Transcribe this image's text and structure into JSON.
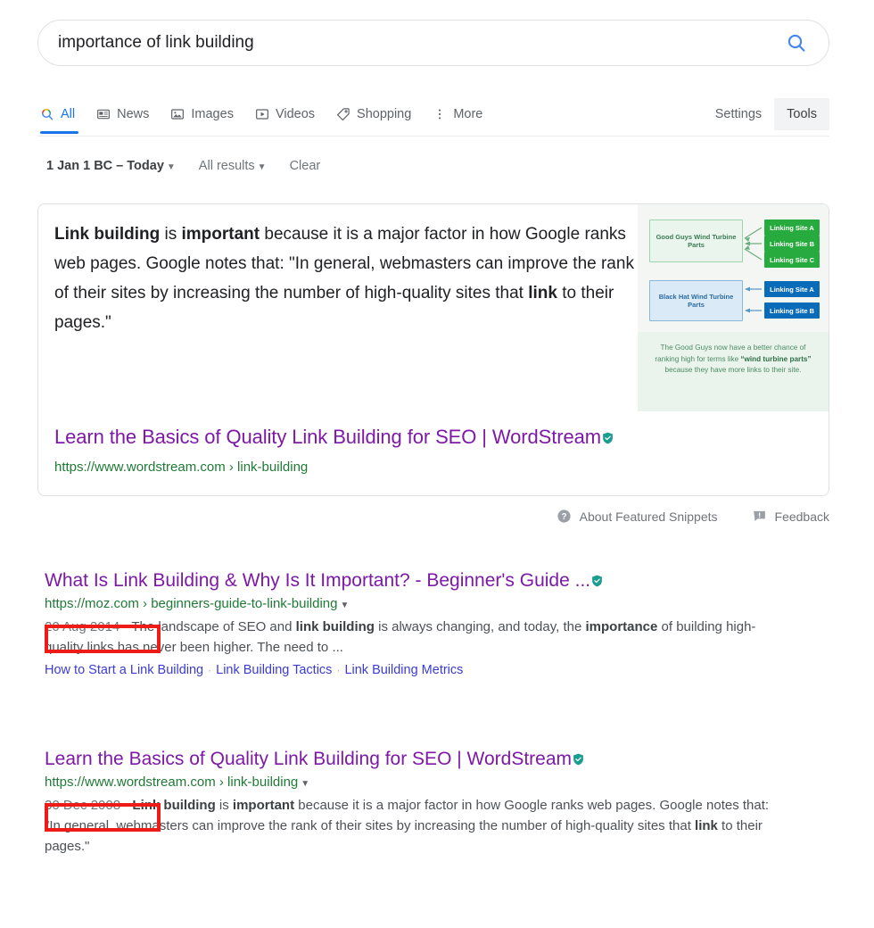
{
  "search": {
    "query": "importance of link building",
    "placeholder": "Search",
    "search_icon": "search-icon"
  },
  "tabs": [
    {
      "label": "All",
      "icon": "search-icon",
      "active": true
    },
    {
      "label": "News",
      "icon": "news-icon",
      "active": false
    },
    {
      "label": "Images",
      "icon": "image-icon",
      "active": false
    },
    {
      "label": "Videos",
      "icon": "video-icon",
      "active": false
    },
    {
      "label": "Shopping",
      "icon": "tag-icon",
      "active": false
    },
    {
      "label": "More",
      "icon": "more-vert-icon",
      "active": false
    }
  ],
  "tab_actions": {
    "settings": "Settings",
    "tools": "Tools"
  },
  "tools_row": {
    "date_range": "1 Jan 1 BC – Today",
    "result_type": "All results",
    "clear": "Clear",
    "caret": "▼"
  },
  "featured_snippet": {
    "text_parts": [
      {
        "text": "Link building",
        "bold": true
      },
      {
        "text": " is ",
        "bold": false
      },
      {
        "text": "important",
        "bold": true
      },
      {
        "text": " because it is a major factor in how Google ranks web pages. Google notes that: \"In general, webmasters can improve the rank of their sites by increasing the number of high-quality sites that ",
        "bold": false
      },
      {
        "text": "link",
        "bold": true
      },
      {
        "text": " to their pages.\"",
        "bold": false
      }
    ],
    "title": "Learn the Basics of Quality Link Building for SEO | WordStream",
    "url": "https://www.wordstream.com › link-building",
    "badge_icon": "verified-shield-icon",
    "thumbnail": {
      "good_box": "Good Guys Wind Turbine Parts",
      "bad_box": "Black Hat Wind Turbine Parts",
      "good_links": [
        "Linking Site A",
        "Linking Site B",
        "Linking Site C"
      ],
      "bad_links": [
        "Linking Site A",
        "Linking Site B"
      ],
      "caption_pre": "The Good Guys now have a better chance of ranking high for terms like ",
      "caption_bold": "“wind turbine parts”",
      "caption_post": " because they have more links to their site.",
      "colors": {
        "good_fill": "#eaf6ed",
        "good_link_fill": "#27ab3e",
        "bad_fill": "#dbeaf7",
        "bad_link_fill": "#0a6bb8",
        "caption_bg": "#eaf4ec"
      }
    },
    "footer": {
      "about": "About Featured Snippets",
      "about_icon": "help-circle-icon",
      "feedback": "Feedback",
      "feedback_icon": "flag-icon"
    }
  },
  "results": [
    {
      "title": "What Is Link Building & Why Is It Important? - Beginner's Guide ...",
      "badge_icon": "verified-shield-icon",
      "url": "https://moz.com › beginners-guide-to-link-building",
      "url_caret": "▼",
      "date": "20 Aug 2014",
      "desc_parts": [
        {
          "text": " - The landscape of SEO and ",
          "bold": false
        },
        {
          "text": "link building",
          "bold": true
        },
        {
          "text": " is always changing, and today, the ",
          "bold": false
        },
        {
          "text": "importance",
          "bold": true
        },
        {
          "text": " of building high-quality links has never been higher. The need to ...",
          "bold": false
        }
      ],
      "sitelinks": [
        "How to Start a Link Building",
        "Link Building Tactics",
        "Link Building Metrics"
      ],
      "sitelink_separator": "·"
    },
    {
      "title": "Learn the Basics of Quality Link Building for SEO | WordStream",
      "badge_icon": "verified-shield-icon",
      "url": "https://www.wordstream.com › link-building",
      "url_caret": "▼",
      "date": "30 Dec 2008",
      "desc_parts": [
        {
          "text": " - ",
          "bold": false
        },
        {
          "text": "Link building",
          "bold": true
        },
        {
          "text": " is ",
          "bold": false
        },
        {
          "text": "important",
          "bold": true
        },
        {
          "text": " because it is a major factor in how Google ranks web pages. Google notes that: \"In general, webmasters can improve the rank of their sites by increasing the number of high-quality sites that ",
          "bold": false
        },
        {
          "text": "link",
          "bold": true
        },
        {
          "text": " to their pages.\"",
          "bold": false
        }
      ],
      "sitelinks": [],
      "sitelink_separator": "·"
    }
  ],
  "annotations": {
    "highlight_color": "#ee1c16",
    "boxes": [
      {
        "label": "date-highlight-1",
        "target": "20 Aug 2014"
      },
      {
        "label": "date-highlight-2",
        "target": "30 Dec 2008"
      }
    ]
  },
  "colors": {
    "link_visited": "#7d19a6",
    "url_green": "#1f7a36",
    "accent_blue": "#1a73e8",
    "text": "#202124",
    "muted": "#70757a"
  }
}
